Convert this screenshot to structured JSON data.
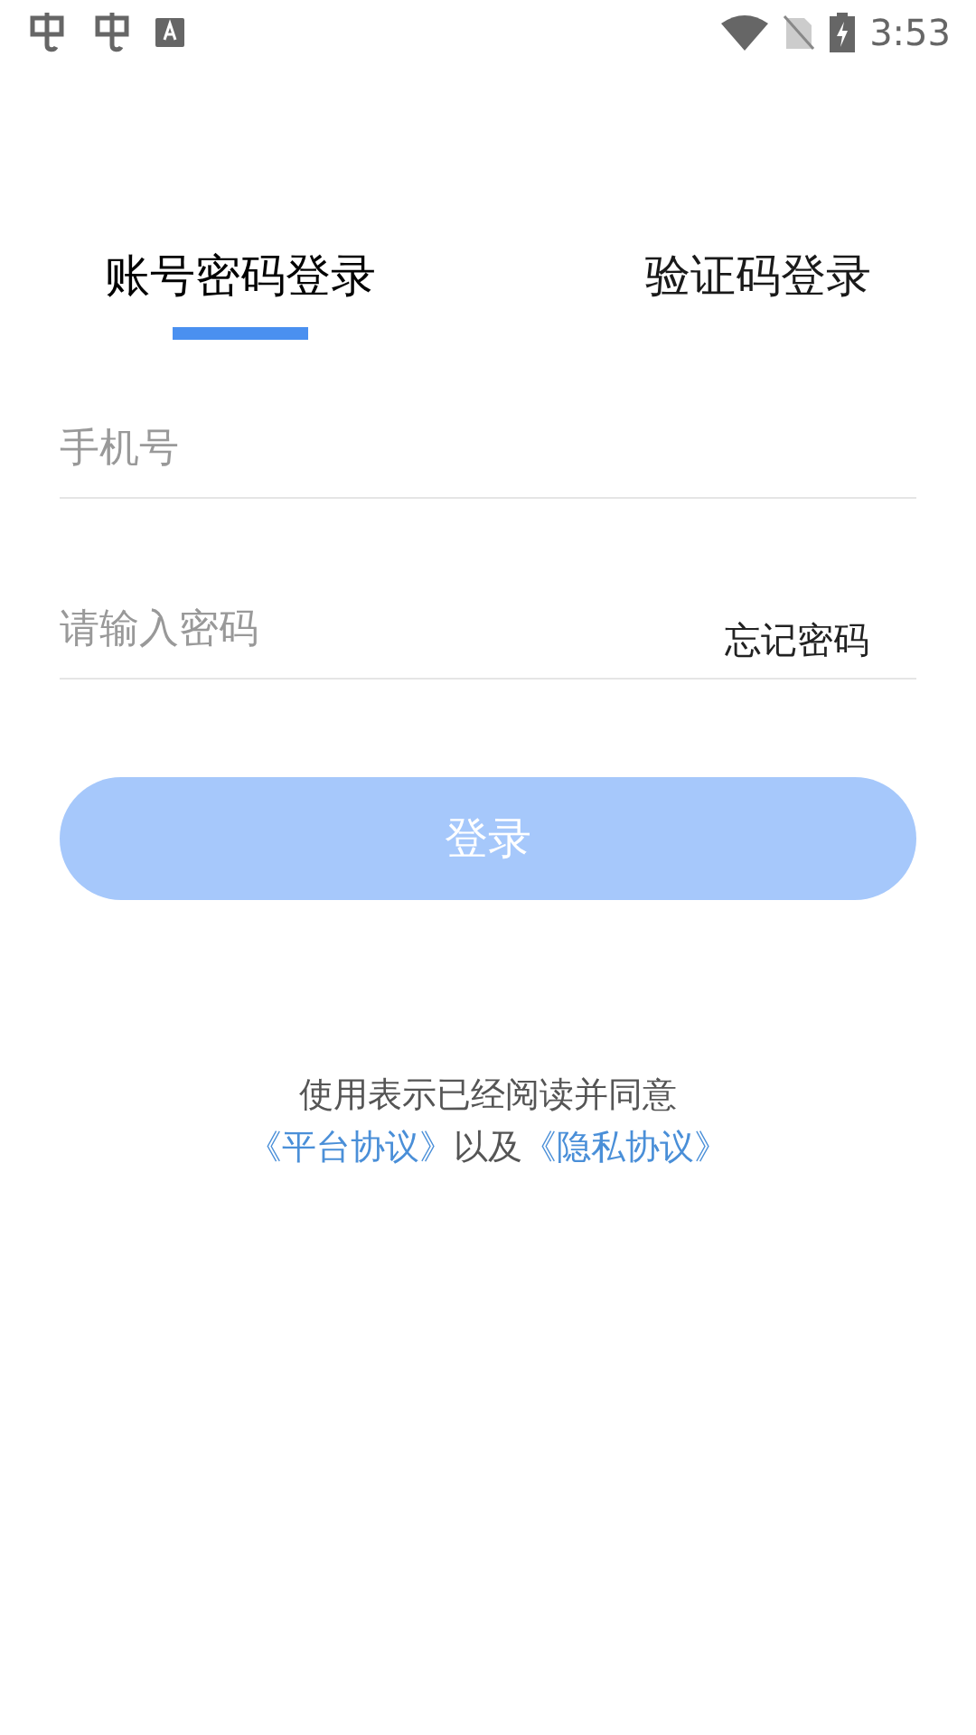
{
  "status_bar": {
    "time": "3:53"
  },
  "tabs": [
    {
      "label": "账号密码登录",
      "selected": true
    },
    {
      "label": "验证码登录",
      "selected": false
    }
  ],
  "phone_field": {
    "placeholder": "手机号"
  },
  "password_field": {
    "placeholder": "请输入密码"
  },
  "forgot_password": "忘记密码",
  "login_button": {
    "label": "登录",
    "disabled": true
  },
  "agreement": {
    "intro": "使用表示已经阅读并同意",
    "parts": [
      {
        "kind": "link",
        "text": "《平台协议》"
      },
      {
        "kind": "plain",
        "text": "以及"
      },
      {
        "kind": "link",
        "text": "《隐私协议》"
      }
    ]
  }
}
